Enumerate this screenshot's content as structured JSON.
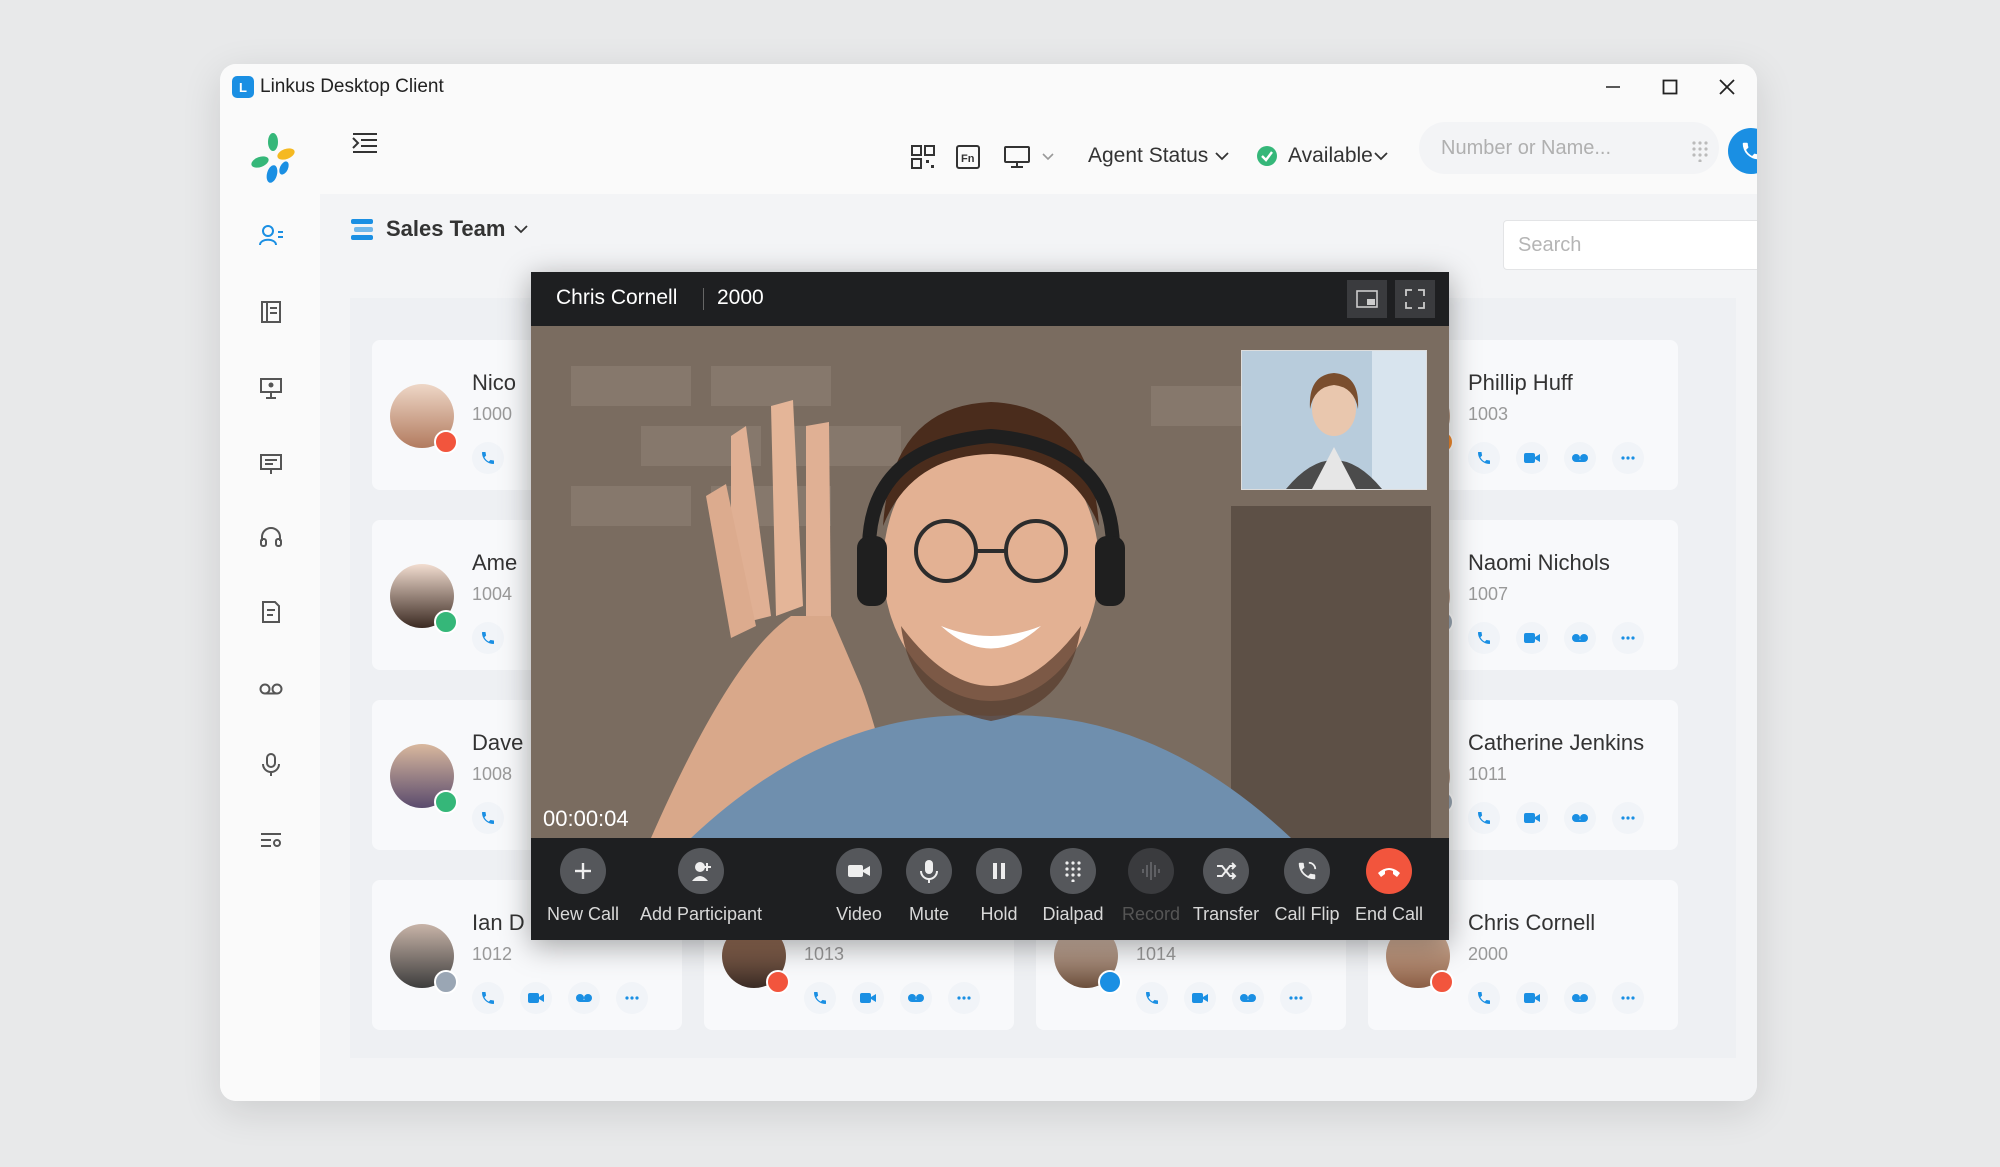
{
  "window": {
    "title": "Linkus Desktop Client",
    "app_icon_letter": "L"
  },
  "topbar": {
    "agent_status_label": "Agent Status",
    "presence_label": "Available",
    "dial_placeholder": "Number or Name..."
  },
  "content": {
    "team_label": "Sales Team",
    "search_placeholder": "Search"
  },
  "contacts": [
    {
      "name": "Nico",
      "ext": "1000",
      "status_color": "#f2553d"
    },
    {
      "name": "Ame",
      "ext": "1004",
      "status_color": "#35b779"
    },
    {
      "name": "Dave",
      "ext": "1008",
      "status_color": "#35b779"
    },
    {
      "name": "Ian D",
      "ext": "1012",
      "status_color": "#9aa6b4"
    },
    {
      "name": "",
      "ext": "1013",
      "status_color": "#f2553d"
    },
    {
      "name": "",
      "ext": "1014",
      "status_color": "#1a8fe3"
    },
    {
      "name": "Phillip Huff",
      "ext": "1003",
      "status_color": "#f28a2e"
    },
    {
      "name": "Naomi Nichols",
      "ext": "1007",
      "status_color": "#9aa6b4"
    },
    {
      "name": "Catherine Jenkins",
      "ext": "1011",
      "status_color": "#9aa6b4"
    },
    {
      "name": "Chris Cornell",
      "ext": "2000",
      "status_color": "#f2553d"
    }
  ],
  "video_call": {
    "caller_name": "Chris Cornell",
    "caller_number": "2000",
    "duration": "00:00:04",
    "controls": {
      "new_call": "New Call",
      "add_participant": "Add Participant",
      "video": "Video",
      "mute": "Mute",
      "hold": "Hold",
      "dialpad": "Dialpad",
      "record": "Record",
      "transfer": "Transfer",
      "call_flip": "Call Flip",
      "end_call": "End Call"
    }
  },
  "colors": {
    "accent": "#1a8fe3",
    "end_call": "#f2553d",
    "available": "#35b779"
  }
}
